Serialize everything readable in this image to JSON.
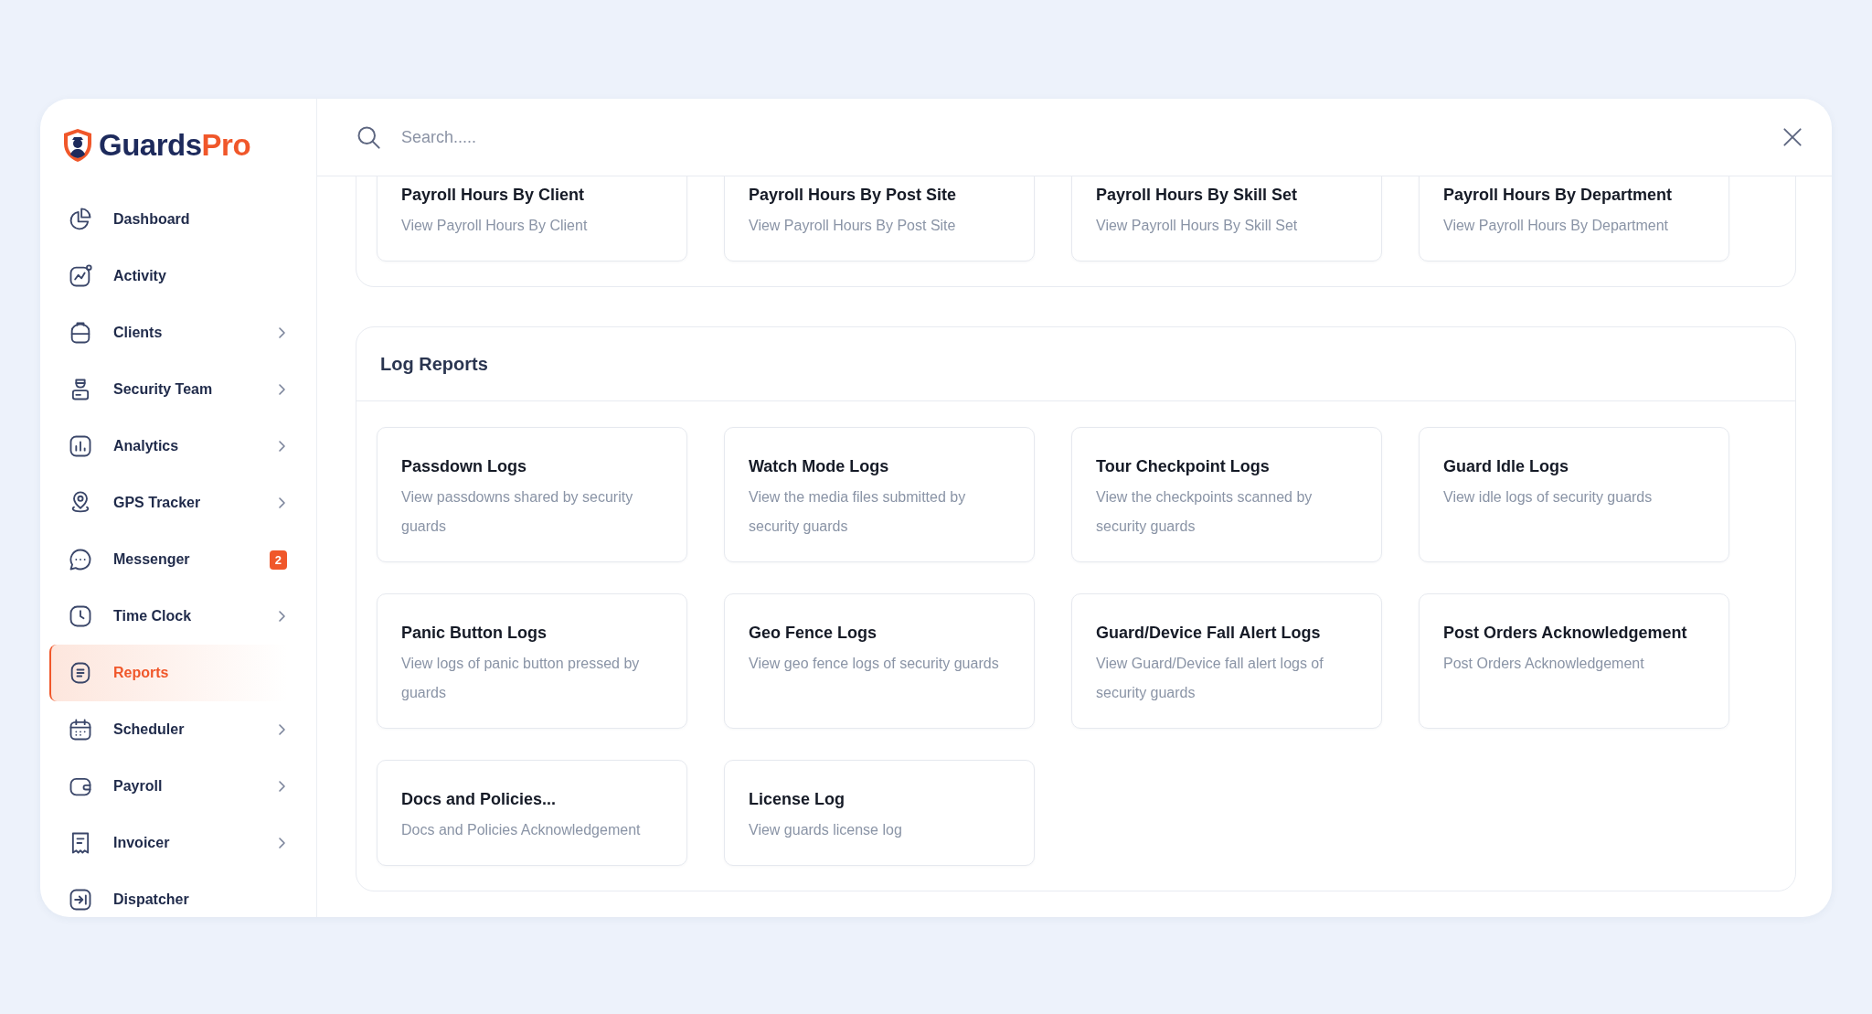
{
  "logo": {
    "text": "Guards",
    "accent": "Pro"
  },
  "sidebar": {
    "items": [
      {
        "label": "Dashboard",
        "selected": false,
        "expandable": false
      },
      {
        "label": "Activity",
        "selected": false,
        "expandable": false
      },
      {
        "label": "Clients",
        "selected": false,
        "expandable": true
      },
      {
        "label": "Security Team",
        "selected": false,
        "expandable": true
      },
      {
        "label": "Analytics",
        "selected": false,
        "expandable": true
      },
      {
        "label": "GPS Tracker",
        "selected": false,
        "expandable": true
      },
      {
        "label": "Messenger",
        "selected": false,
        "expandable": false,
        "badge": "2"
      },
      {
        "label": "Time Clock",
        "selected": false,
        "expandable": true
      },
      {
        "label": "Reports",
        "selected": true,
        "expandable": false
      },
      {
        "label": "Scheduler",
        "selected": false,
        "expandable": true
      },
      {
        "label": "Payroll",
        "selected": false,
        "expandable": true
      },
      {
        "label": "Invoicer",
        "selected": false,
        "expandable": true
      },
      {
        "label": "Dispatcher",
        "selected": false,
        "expandable": false
      }
    ]
  },
  "search": {
    "placeholder": "Search....."
  },
  "sections": [
    {
      "cards": [
        {
          "title": "Payroll Hours By Client",
          "description": "View Payroll Hours By Client"
        },
        {
          "title": "Payroll Hours By Post Site",
          "description": "View Payroll Hours By Post Site"
        },
        {
          "title": "Payroll Hours By Skill Set",
          "description": "View Payroll Hours By Skill Set"
        },
        {
          "title": "Payroll Hours By Department",
          "description": "View Payroll Hours By Department"
        }
      ]
    },
    {
      "title": "Log Reports",
      "cards": [
        {
          "title": "Passdown Logs",
          "description": "View passdowns shared by security guards"
        },
        {
          "title": "Watch Mode Logs",
          "description": "View the media files submitted by security guards"
        },
        {
          "title": "Tour Checkpoint Logs",
          "description": "View the checkpoints scanned by security guards"
        },
        {
          "title": "Guard Idle Logs",
          "description": "View idle logs of security guards"
        },
        {
          "title": "Panic Button Logs",
          "description": "View logs of panic button pressed by guards"
        },
        {
          "title": "Geo Fence Logs",
          "description": "View geo fence logs of security guards"
        },
        {
          "title": "Guard/Device Fall Alert Logs",
          "description": "View Guard/Device fall alert logs of security guards"
        },
        {
          "title": "Post Orders Acknowledgement",
          "description": "Post Orders Acknowledgement"
        },
        {
          "title": "Docs and Policies...",
          "description": "Docs and Policies Acknowledgement"
        },
        {
          "title": "License Log",
          "description": "View guards license log"
        }
      ]
    }
  ]
}
